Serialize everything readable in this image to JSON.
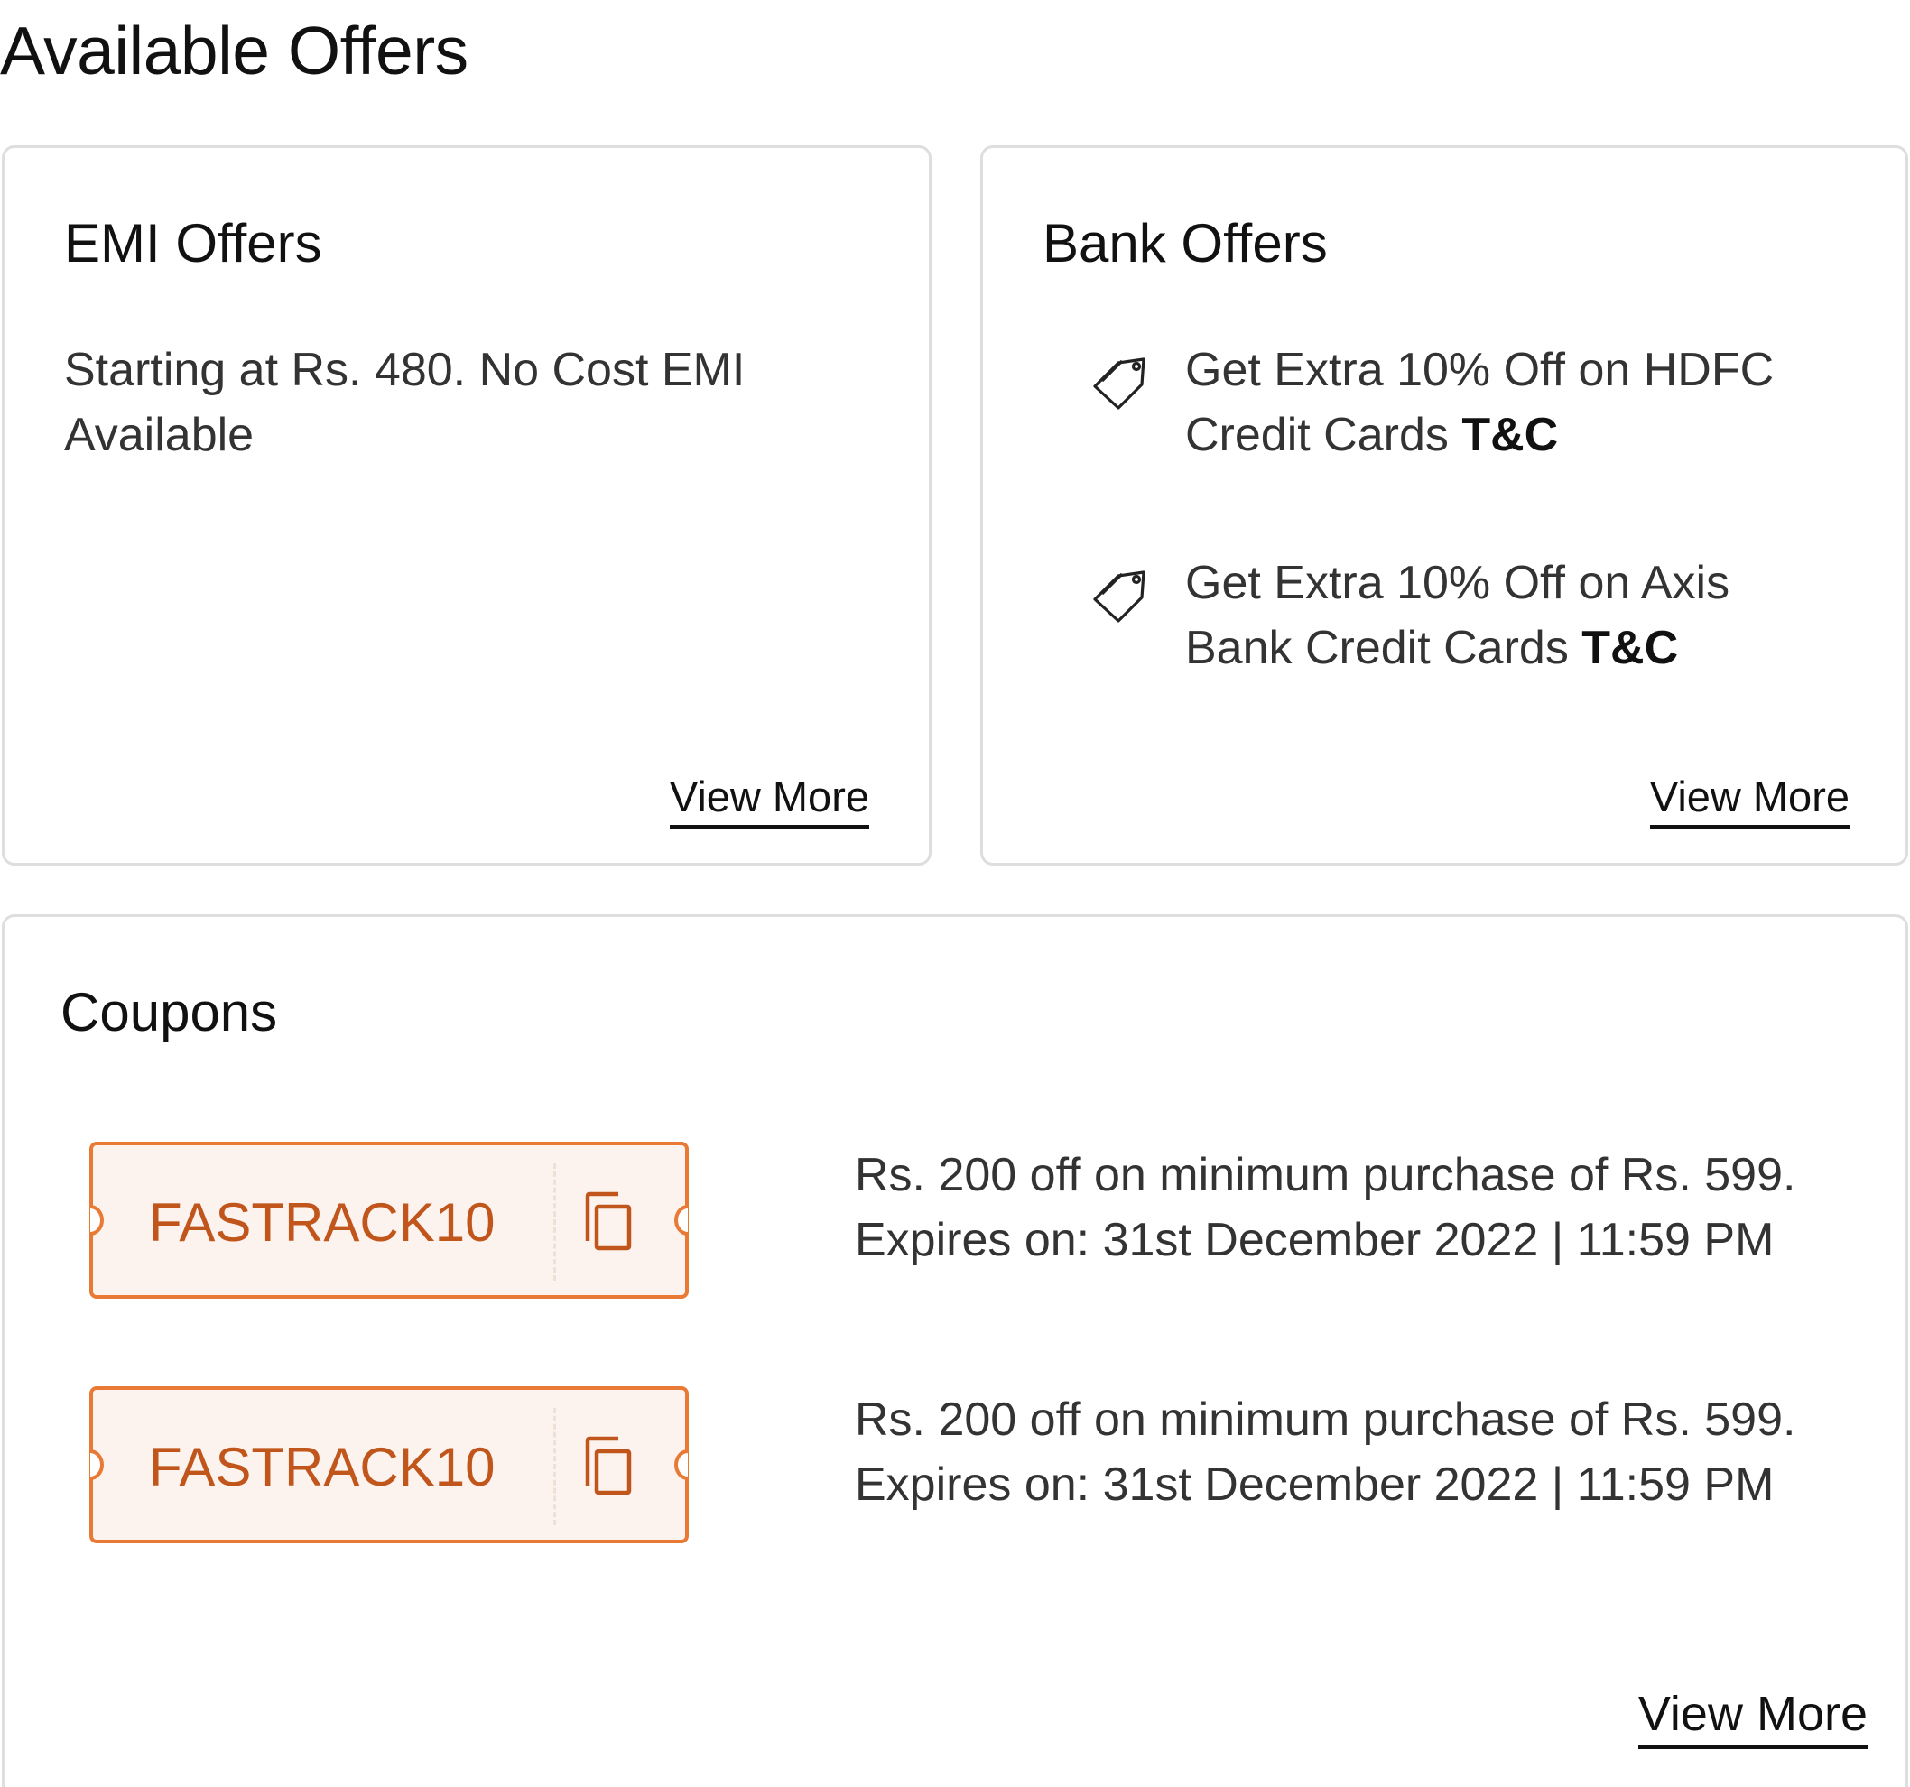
{
  "page": {
    "title": "Available Offers"
  },
  "emi": {
    "title": "EMI Offers",
    "description": "Starting at Rs. 480.  No Cost EMI Available",
    "view_more": "View More"
  },
  "bank": {
    "title": "Bank Offers",
    "offers": [
      {
        "icon": "tag-icon",
        "text": "Get Extra 10% Off on HDFC Credit Cards ",
        "tnc": "T&C"
      },
      {
        "icon": "tag-icon",
        "text": "Get Extra 10% Off on Axis Bank Credit Cards ",
        "tnc": "T&C"
      }
    ],
    "view_more": "View More"
  },
  "coupons": {
    "title": "Coupons",
    "items": [
      {
        "code": "FASTRACK10",
        "icon": "copy-icon",
        "description": "Rs. 200 off on minimum purchase of Rs. 599.",
        "expiry": "Expires on: 31st December 2022 | 11:59 PM"
      },
      {
        "code": "FASTRACK10",
        "icon": "copy-icon",
        "description": "Rs. 200 off on minimum purchase of Rs. 599.",
        "expiry": "Expires on: 31st December 2022 | 11:59 PM"
      }
    ],
    "view_more": "View More"
  },
  "colors": {
    "coupon_border": "#e87a35",
    "coupon_bg": "#fdf3ee",
    "coupon_text": "#c0561c",
    "card_border": "#dedede"
  }
}
